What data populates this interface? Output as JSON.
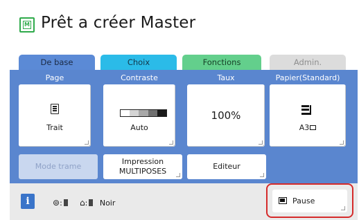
{
  "header": {
    "title": "Prêt a créer Master",
    "icon": "master-icon",
    "icon_letter": "M"
  },
  "tabs": [
    {
      "label": "De base",
      "state": "active"
    },
    {
      "label": "Choix"
    },
    {
      "label": "Fonctions"
    },
    {
      "label": "Admin.",
      "state": "disabled"
    }
  ],
  "columns": [
    {
      "label": "Page",
      "value": "Trait",
      "icon": "document-icon"
    },
    {
      "label": "Contraste",
      "value": "Auto",
      "icon": "contrast-scale-icon"
    },
    {
      "label": "Taux",
      "value": "100%"
    },
    {
      "label": "Papier(Standard)",
      "value": "A3",
      "icon": "paper-tray-icon"
    }
  ],
  "buttons": {
    "mode_trame": "Mode trame",
    "impression_line1": "Impression",
    "impression_line2": "MULTIPOSES",
    "editeur": "Editeur"
  },
  "status": {
    "info": "i",
    "drum_label": "Noir",
    "pause": "Pause"
  },
  "colors": {
    "panel": "#5a86cf",
    "tab_base": "#5b8ad6",
    "tab_choix": "#2bbbe8",
    "tab_fonctions": "#63cf8c",
    "highlight": "#d52a2a"
  }
}
